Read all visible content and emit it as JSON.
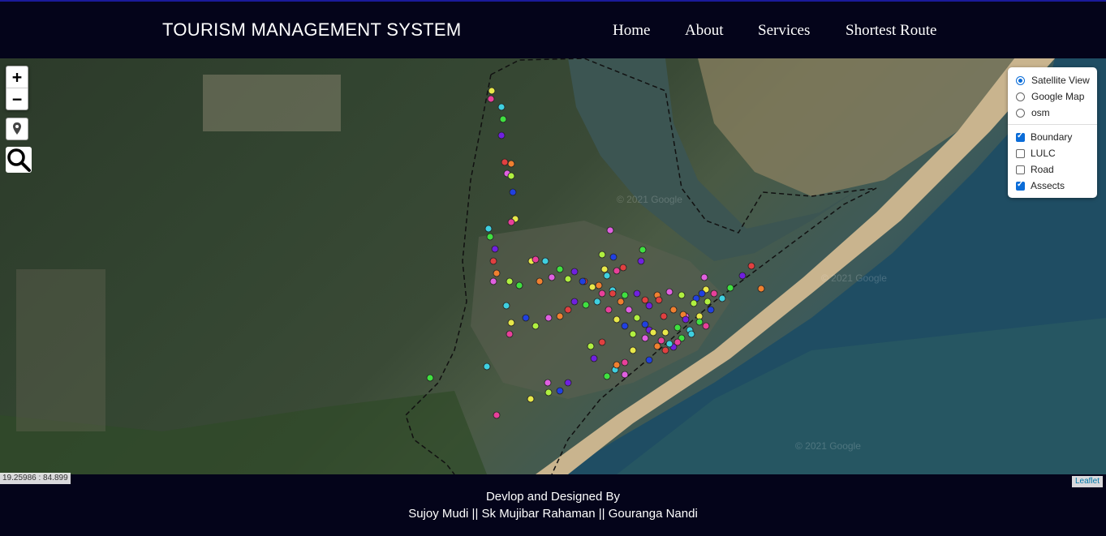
{
  "header": {
    "title": "TOURISM MANAGEMENT SYSTEM",
    "nav": [
      "Home",
      "About",
      "Services",
      "Shortest Route"
    ]
  },
  "map": {
    "zoom_in": "+",
    "zoom_out": "−",
    "coordinates": "19.25986 : 84.899",
    "attribution": "Leaflet",
    "watermark": "© 2021 Google",
    "base_layers": [
      {
        "label": "Satellite View",
        "selected": true
      },
      {
        "label": "Google Map",
        "selected": false
      },
      {
        "label": "osm",
        "selected": false
      }
    ],
    "overlays": [
      {
        "label": "Boundary",
        "checked": true
      },
      {
        "label": "LULC",
        "checked": false
      },
      {
        "label": "Road",
        "checked": false
      },
      {
        "label": "Assects",
        "checked": true
      }
    ]
  },
  "footer": {
    "line1": "Devlop and Designed By",
    "line2": "Sujoy Mudi || Sk Mujibar Rahaman || Gouranga Nandi"
  },
  "colors": {
    "header_bg": "#04041a",
    "marker_palette": [
      "#e8e84a",
      "#e8409a",
      "#3fd0e0",
      "#40e040",
      "#7020e0",
      "#e04040",
      "#f08030",
      "#e060e0",
      "#b0f040",
      "#2040e0"
    ]
  }
}
